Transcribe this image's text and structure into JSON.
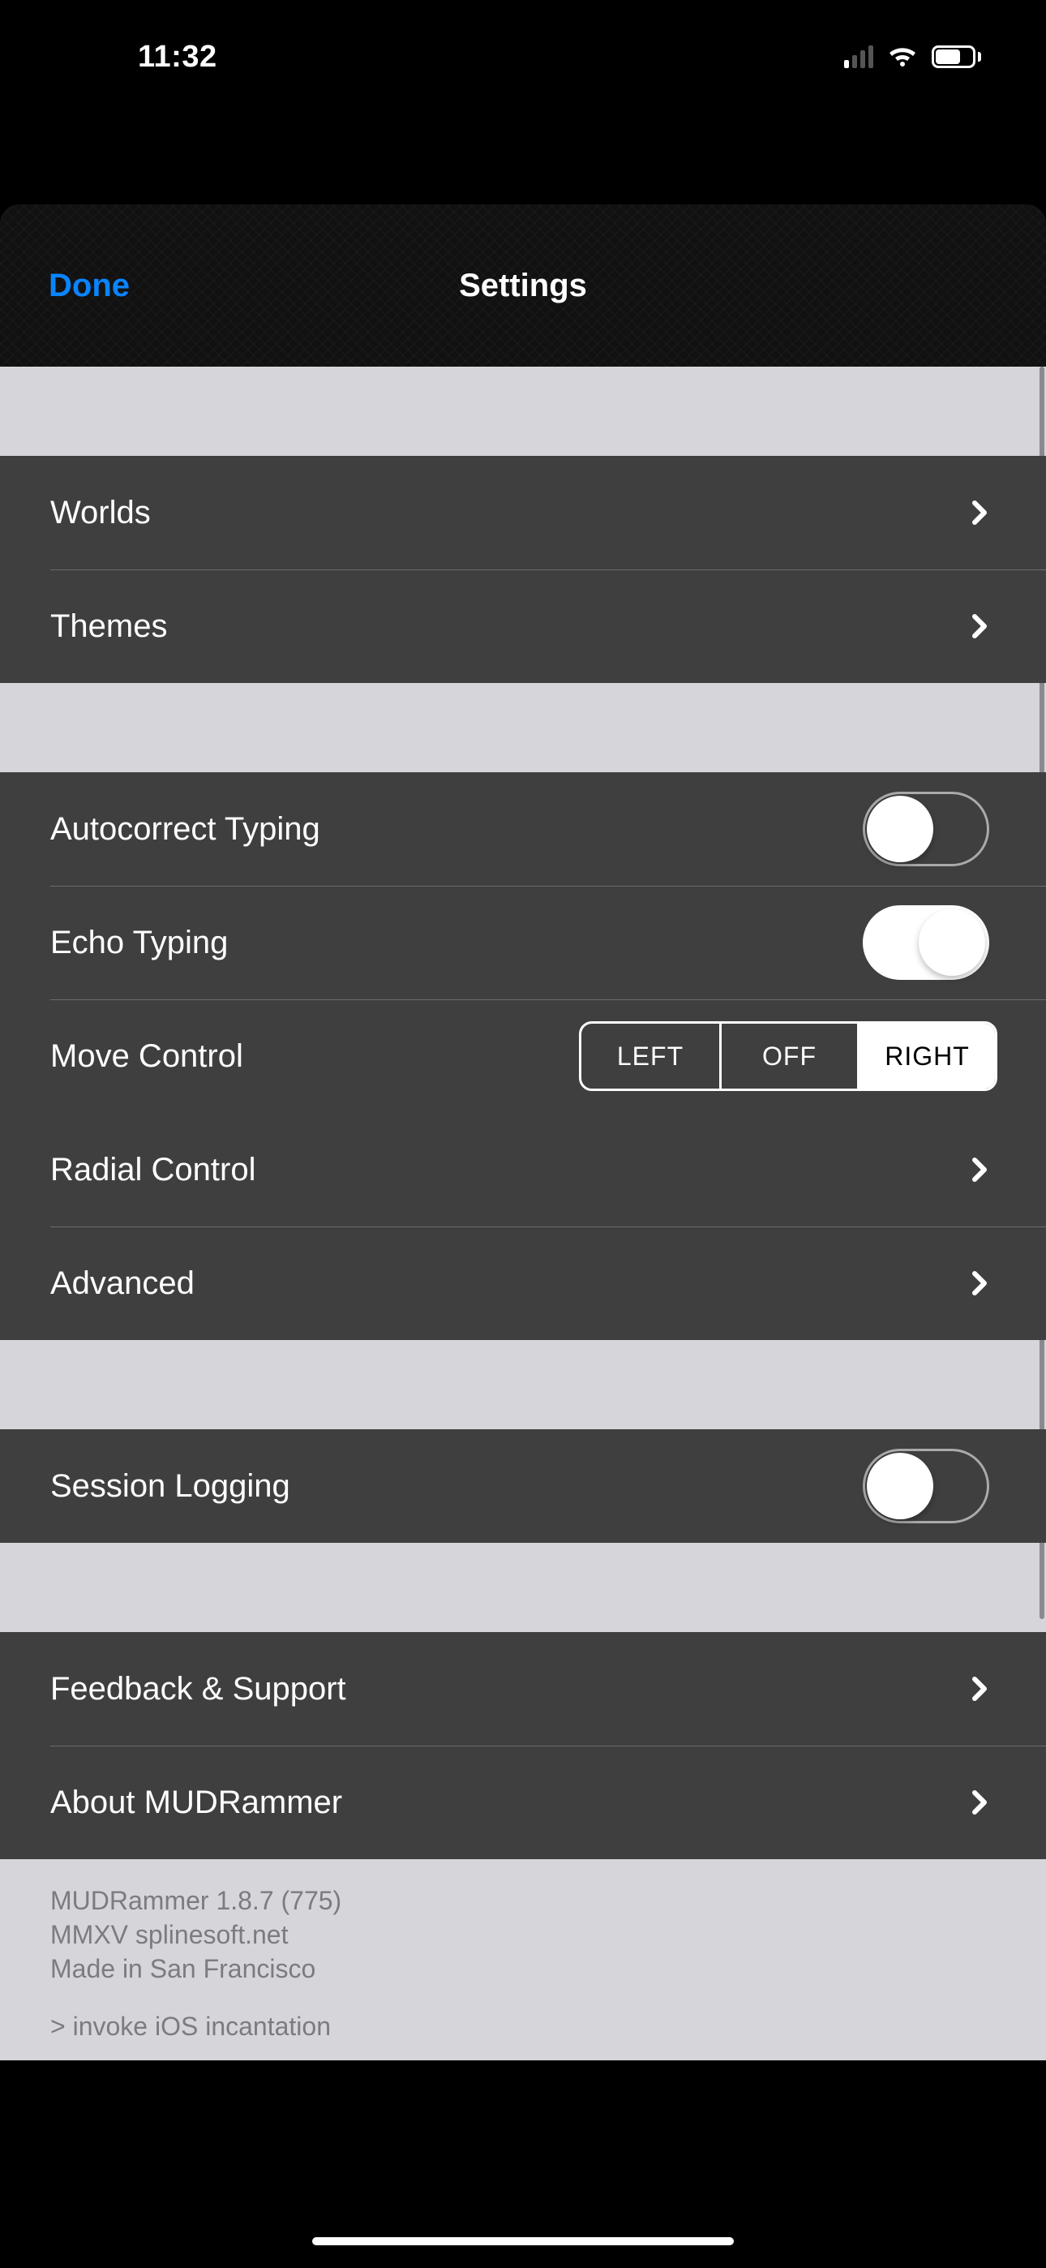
{
  "status": {
    "time": "11:32"
  },
  "nav": {
    "done": "Done",
    "title": "Settings"
  },
  "section1": {
    "worlds": "Worlds",
    "themes": "Themes"
  },
  "section2": {
    "autocorrect": "Autocorrect Typing",
    "echo": "Echo Typing",
    "move_control": "Move Control",
    "seg_left": "LEFT",
    "seg_off": "OFF",
    "seg_right": "RIGHT",
    "radial": "Radial Control",
    "advanced": "Advanced"
  },
  "section3": {
    "session_logging": "Session Logging"
  },
  "section4": {
    "feedback": "Feedback & Support",
    "about": "About MUDRammer"
  },
  "footer": {
    "line1": "MUDRammer 1.8.7 (775)",
    "line2": "MMXV splinesoft.net",
    "line3": "Made in San Francisco",
    "line4": "> invoke iOS incantation"
  },
  "switches": {
    "autocorrect_on": false,
    "echo_on": true,
    "session_logging_on": false
  },
  "segmented_selected": "RIGHT"
}
